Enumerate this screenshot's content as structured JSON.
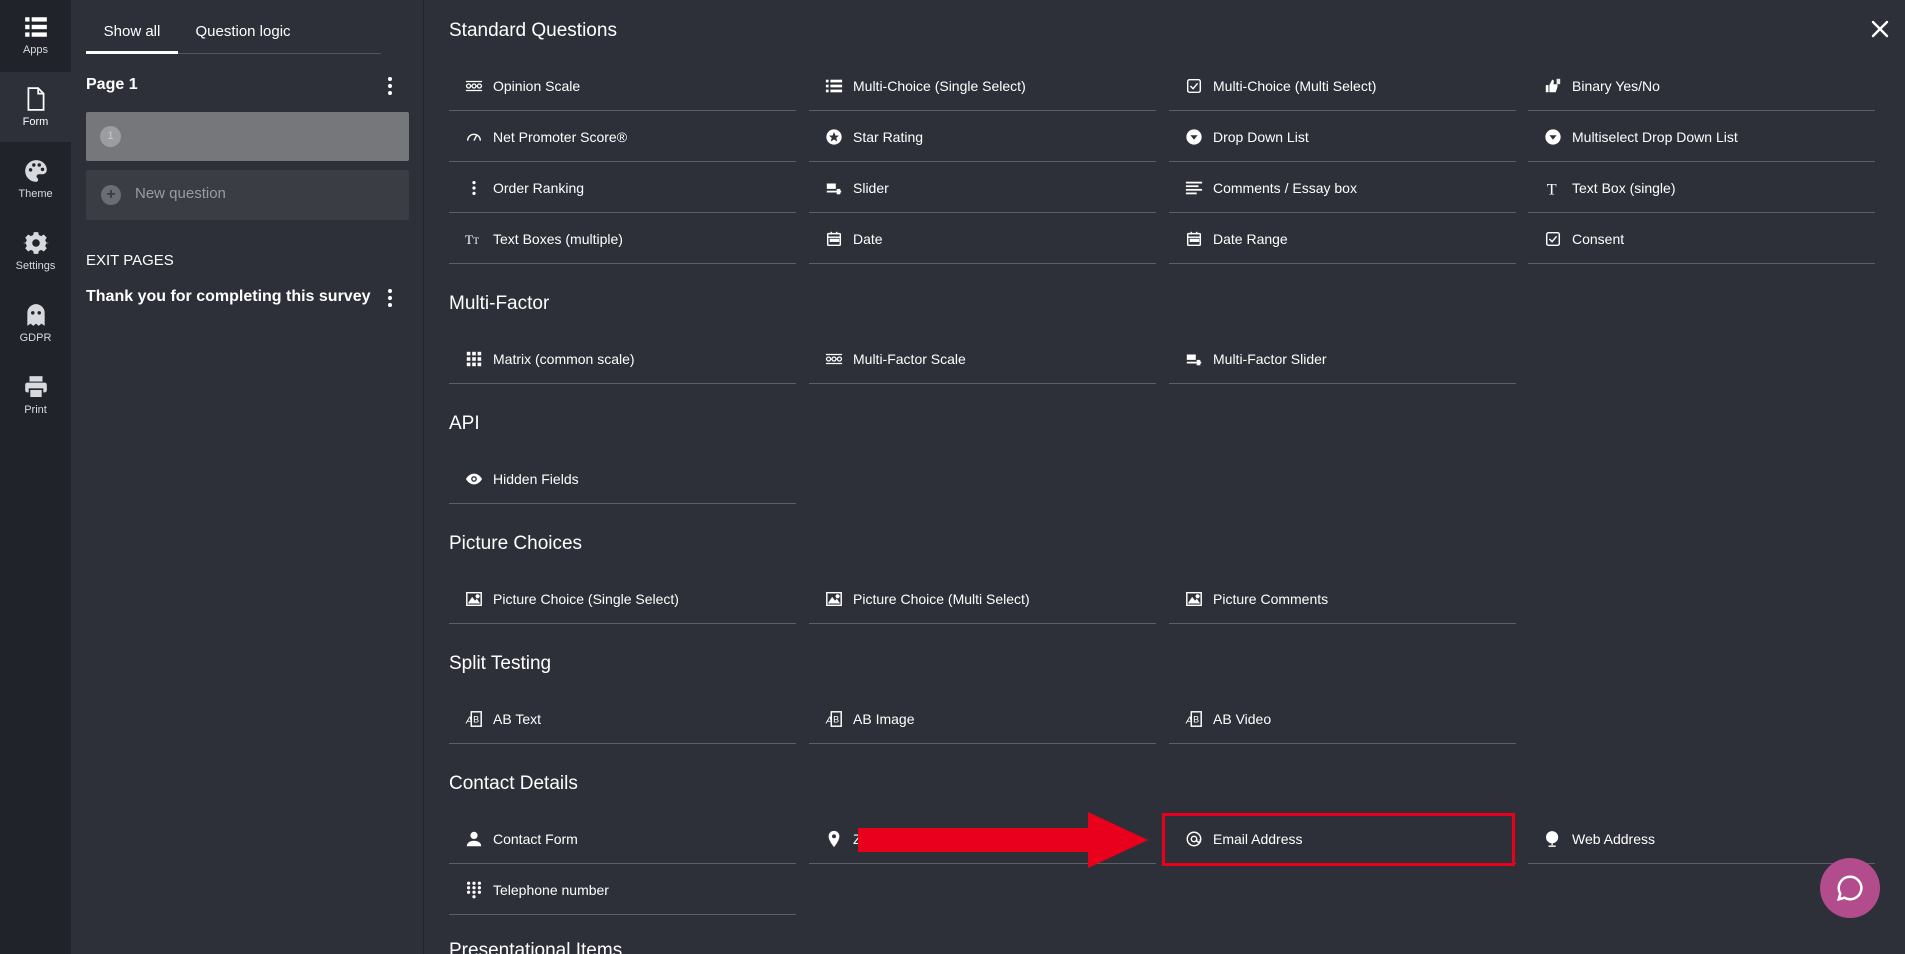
{
  "rail": {
    "items": [
      {
        "label": "Apps",
        "icon": "apps-grid-icon"
      },
      {
        "label": "Form",
        "icon": "form-document-icon"
      },
      {
        "label": "Theme",
        "icon": "palette-icon"
      },
      {
        "label": "Settings",
        "icon": "gear-icon"
      },
      {
        "label": "GDPR",
        "icon": "ghost-icon"
      },
      {
        "label": "Print",
        "icon": "printer-icon"
      }
    ]
  },
  "pages_panel": {
    "tabs": [
      "Show all",
      "Question logic"
    ],
    "page_heading": "Page 1",
    "question_number": "1",
    "new_question": "New question",
    "exit_heading": "EXIT PAGES",
    "exit_page": "Thank you for completing this survey"
  },
  "sections": [
    {
      "title": "Standard Questions",
      "items": [
        {
          "label": "Opinion Scale",
          "icon": "opinion-scale-icon"
        },
        {
          "label": "Multi-Choice (Single Select)",
          "icon": "list-icon"
        },
        {
          "label": "Multi-Choice (Multi Select)",
          "icon": "checkbox-icon"
        },
        {
          "label": "Binary Yes/No",
          "icon": "thumbs-icon"
        },
        {
          "label": "Net Promoter Score®",
          "icon": "gauge-icon"
        },
        {
          "label": "Star Rating",
          "icon": "star-icon"
        },
        {
          "label": "Drop Down List",
          "icon": "dropdown-icon"
        },
        {
          "label": "Multiselect Drop Down List",
          "icon": "dropdown-icon"
        },
        {
          "label": "Order Ranking",
          "icon": "ranking-icon"
        },
        {
          "label": "Slider",
          "icon": "slider-icon"
        },
        {
          "label": "Comments / Essay box",
          "icon": "paragraph-icon"
        },
        {
          "label": "Text Box (single)",
          "icon": "text-icon"
        },
        {
          "label": "Text Boxes (multiple)",
          "icon": "text-size-icon"
        },
        {
          "label": "Date",
          "icon": "calendar-icon"
        },
        {
          "label": "Date Range",
          "icon": "calendar-icon"
        },
        {
          "label": "Consent",
          "icon": "checkbox-icon"
        }
      ]
    },
    {
      "title": "Multi-Factor",
      "items": [
        {
          "label": "Matrix (common scale)",
          "icon": "matrix-icon"
        },
        {
          "label": "Multi-Factor Scale",
          "icon": "opinion-scale-icon"
        },
        {
          "label": "Multi-Factor Slider",
          "icon": "slider-icon"
        }
      ]
    },
    {
      "title": "API",
      "items": [
        {
          "label": "Hidden Fields",
          "icon": "eye-icon"
        }
      ]
    },
    {
      "title": "Picture Choices",
      "items": [
        {
          "label": "Picture Choice (Single Select)",
          "icon": "picture-icon"
        },
        {
          "label": "Picture Choice (Multi Select)",
          "icon": "picture-icon"
        },
        {
          "label": "Picture Comments",
          "icon": "picture-icon"
        }
      ]
    },
    {
      "title": "Split Testing",
      "items": [
        {
          "label": "AB Text",
          "icon": "ab-test-icon"
        },
        {
          "label": "AB Image",
          "icon": "ab-test-icon"
        },
        {
          "label": "AB Video",
          "icon": "ab-test-icon"
        }
      ]
    },
    {
      "title": "Contact Details",
      "items": [
        {
          "label": "Contact Form",
          "icon": "person-icon"
        },
        {
          "label": "Z",
          "icon": "location-pin-icon"
        },
        {
          "label": "Email Address",
          "icon": "at-sign-icon"
        },
        {
          "label": "Web Address",
          "icon": "globe-icon"
        },
        {
          "label": "Telephone number",
          "icon": "keypad-icon"
        }
      ]
    },
    {
      "title": "Presentational Items",
      "items": []
    }
  ],
  "colors": {
    "background": "#2d3038",
    "rail": "#202329",
    "highlight": "#e8001c",
    "chat": "#b24c8c"
  }
}
